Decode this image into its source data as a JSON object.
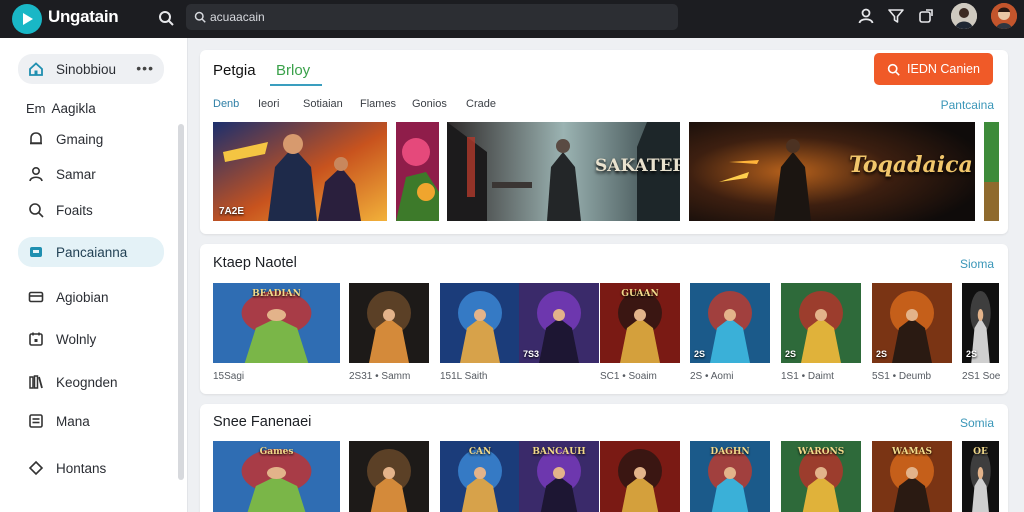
{
  "app": {
    "brand": "Ungatain",
    "search_placeholder": "acuaacain"
  },
  "sidebar": {
    "items": [
      {
        "label": "Sinobbiou",
        "icon": "home-icon"
      },
      {
        "label": "Aagikla",
        "icon": "list-icon",
        "prefix": "Em"
      },
      {
        "label": "Gmaing",
        "icon": "bell-icon"
      },
      {
        "label": "Samar",
        "icon": "user-icon"
      },
      {
        "label": "Foaits",
        "icon": "search-icon"
      },
      {
        "label": "Pancaianna",
        "icon": "store-icon"
      },
      {
        "label": "Agiobian",
        "icon": "card-icon"
      },
      {
        "label": "Wolnly",
        "icon": "calendar-icon"
      },
      {
        "label": "Keognden",
        "icon": "library-icon"
      },
      {
        "label": "Mana",
        "icon": "document-icon"
      },
      {
        "label": "Hontans",
        "icon": "diamond-icon"
      }
    ]
  },
  "featured": {
    "tabs": [
      "Petgia",
      "Brloy"
    ],
    "cta_label": "IEDN Canien",
    "chips": [
      "Denb",
      "Ieori",
      "Sotiaian",
      "Flames",
      "Gonios",
      "Crade"
    ],
    "see_all": "Pantcaina",
    "banners": [
      {
        "label": "7A2E",
        "title": ""
      },
      {
        "label": "",
        "title": ""
      },
      {
        "label": "",
        "title": "SAKATER"
      },
      {
        "label": "",
        "title": "Toqadaica"
      },
      {
        "label": "",
        "title": ""
      }
    ]
  },
  "section_one": {
    "title": "Ktaep Naotel",
    "see_all": "Sioma",
    "tiles": [
      {
        "title": "BEADIAN",
        "badge": "",
        "meta": "15Sagi"
      },
      {
        "title": "",
        "badge": "",
        "meta": "2S31 • Samm"
      },
      {
        "title": "",
        "badge": "",
        "meta": "151L Saith"
      },
      {
        "title": "",
        "badge": "7S3",
        "meta": ""
      },
      {
        "title": "GUAAN",
        "badge": "",
        "meta": "SC1 • Soaim"
      },
      {
        "title": "",
        "badge": "2S",
        "meta": "2S • Aomi"
      },
      {
        "title": "",
        "badge": "2S",
        "meta": "1S1 • Daimt"
      },
      {
        "title": "",
        "badge": "2S",
        "meta": "5S1 • Deumb"
      },
      {
        "title": "",
        "badge": "2S",
        "meta": "2S1 Soe"
      }
    ]
  },
  "section_two": {
    "title": "Snee Fanenaei",
    "see_all": "Somia",
    "tiles": [
      {
        "title": "Games"
      },
      {
        "title": ""
      },
      {
        "title": "CAN"
      },
      {
        "title": "BANCAUH"
      },
      {
        "title": ""
      },
      {
        "title": "DAGHN"
      },
      {
        "title": "WARONS"
      },
      {
        "title": "WAMAS"
      },
      {
        "title": "OE"
      }
    ]
  },
  "colors": {
    "accent": "#f05a28",
    "link": "#3a96b8",
    "topbar": "#1c1d21",
    "active_nav": "#e4f2f7"
  }
}
